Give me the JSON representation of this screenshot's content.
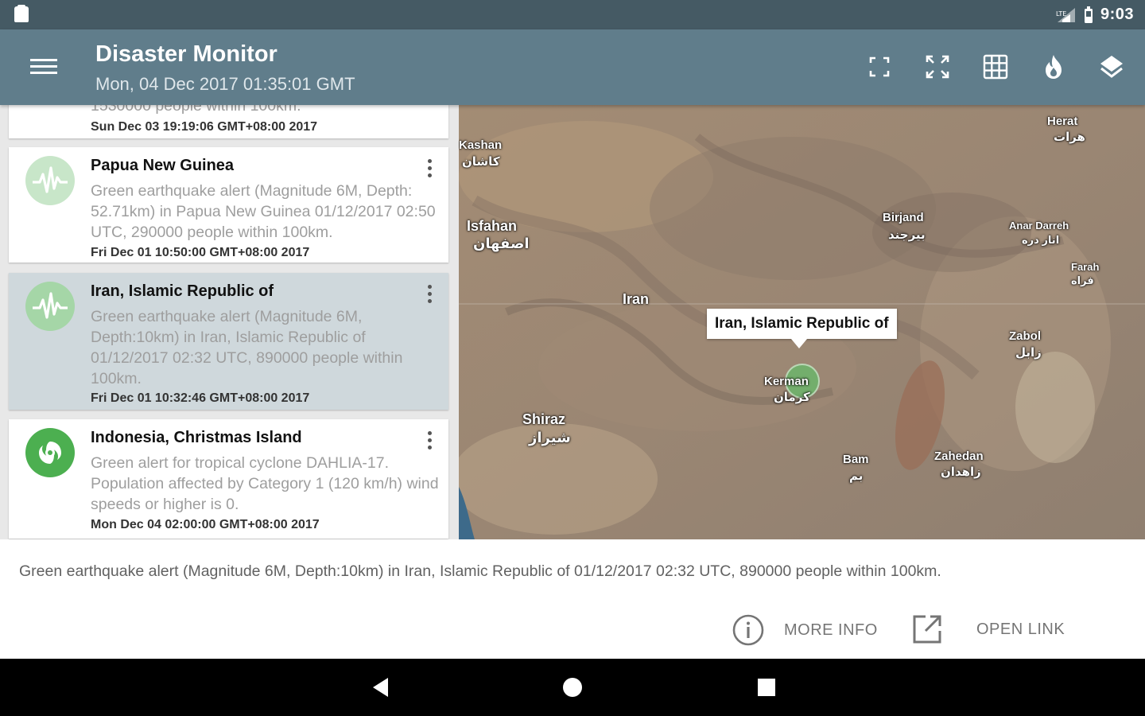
{
  "status_bar": {
    "time": "9:03"
  },
  "app_bar": {
    "title": "Disaster Monitor",
    "subtitle": "Mon, 04 Dec 2017 01:35:01 GMT",
    "icons": [
      "fullscreen-exit-icon",
      "fullscreen-icon",
      "grid-icon",
      "fire-icon",
      "layers-icon"
    ]
  },
  "list": {
    "partial_item": {
      "desc_tail": "1530000 people within 100km.",
      "date": "Sun Dec 03 19:19:06 GMT+08:00 2017"
    },
    "items": [
      {
        "title": "Papua New Guinea",
        "desc": "Green earthquake alert (Magnitude 6M, Depth: 52.71km) in Papua New Guinea 01/12/2017 02:50 UTC, 290000 people within 100km.",
        "date": "Fri Dec 01 10:50:00 GMT+08:00 2017",
        "icon": "earthquake-icon"
      },
      {
        "title": "Iran, Islamic Republic of",
        "desc": "Green earthquake alert (Magnitude 6M, Depth:10km) in Iran, Islamic Republic of 01/12/2017 02:32 UTC, 890000 people within 100km.",
        "date": "Fri Dec 01 10:32:46 GMT+08:00 2017",
        "icon": "earthquake-icon",
        "selected": true
      },
      {
        "title": "Indonesia, Christmas Island",
        "desc": "Green alert for tropical cyclone DAHLIA-17. Population affected by Category 1 (120 km/h) wind speeds or higher is 0.",
        "date": "Mon Dec 04 02:00:00 GMT+08:00 2017",
        "icon": "cyclone-icon"
      }
    ]
  },
  "map": {
    "callout": "Iran, Islamic Republic of",
    "labels": {
      "kashan": "Kashan",
      "kashan_fa": "کاشان",
      "isfahan": "Isfahan",
      "isfahan_fa": "اصفهان",
      "iran": "Iran",
      "birjand": "Birjand",
      "birjand_fa": "بیرجند",
      "herat": "Herat",
      "herat_fa": "هرات",
      "anar_darreh": "Anar Darreh",
      "anar_darreh_fa": "انار دره",
      "farah": "Farah",
      "farah_fa": "فراه",
      "zabol": "Zabol",
      "zabol_fa": "زابل",
      "kerman": "Kerman",
      "kerman_fa": "کرمان",
      "shiraz": "Shiraz",
      "shiraz_fa": "شیراز",
      "bam": "Bam",
      "bam_fa": "بم",
      "zahedan": "Zahedan",
      "zahedan_fa": "زاهدان"
    }
  },
  "detail": {
    "text": "Green earthquake alert (Magnitude 6M, Depth:10km) in Iran, Islamic Republic of 01/12/2017 02:32 UTC, 890000 people within 100km.",
    "more_info_label": "MORE INFO",
    "open_link_label": "OPEN LINK"
  },
  "colors": {
    "status_bar": "#455a64",
    "app_bar": "#607d8b",
    "alert_green": "#66bb6a",
    "selected_bg": "#cfd8dc"
  }
}
